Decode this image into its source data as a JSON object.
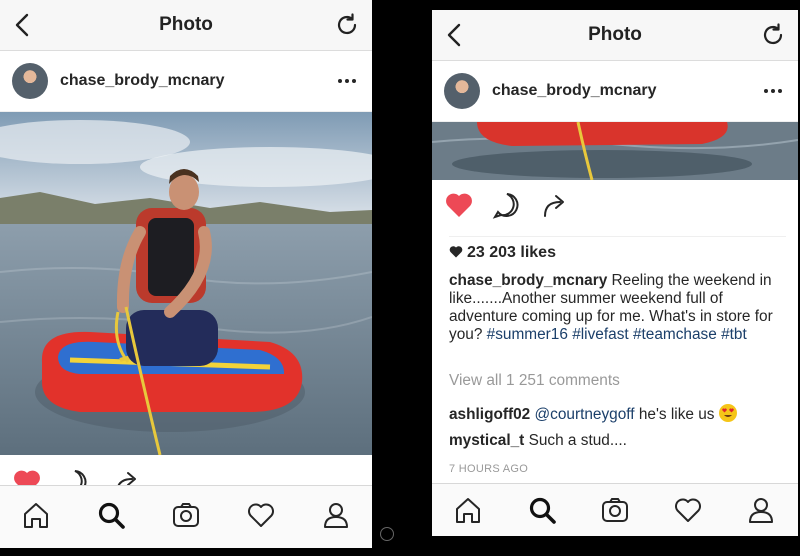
{
  "left_screen": {
    "header": {
      "title": "Photo"
    },
    "post": {
      "username": "chase_brody_mcnary"
    }
  },
  "right_screen": {
    "header": {
      "title": "Photo"
    },
    "post": {
      "username": "chase_brody_mcnary",
      "likes": "23 203 likes",
      "caption_text": " Reeling the weekend in like.......Another summer weekend full of adventure coming up for me.  What's in store for you? ",
      "hashtags": [
        "#summer16",
        "#livefast",
        "#teamchase",
        "#tbt"
      ],
      "view_all_comments": "View all 1 251 comments",
      "comments": [
        {
          "user": "ashligoff02",
          "mention": "@courtneygoff",
          "text": " he's like us "
        },
        {
          "user": "mystical_t",
          "mention": "",
          "text": " Such a stud...."
        }
      ],
      "time_ago": "7 HOURS AGO"
    }
  },
  "icons": {
    "back": "chevron-left-icon",
    "refresh": "refresh-icon",
    "more": "more-options-icon",
    "like": "heart-icon",
    "comment": "comment-icon",
    "share": "share-icon",
    "home": "home-icon",
    "search": "search-icon",
    "camera": "camera-icon",
    "activity": "heart-outline-icon",
    "profile": "profile-icon"
  },
  "colors": {
    "like_red": "#ed4956",
    "hashtag_blue": "#1b3f6a",
    "muted_gray": "#999999"
  }
}
